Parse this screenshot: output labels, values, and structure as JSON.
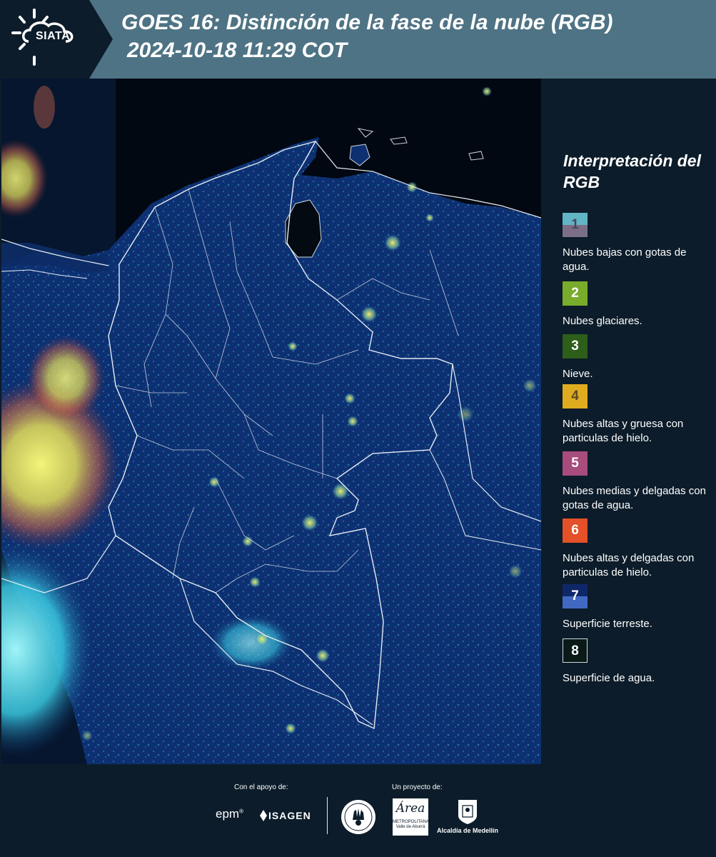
{
  "header": {
    "logo_text": "SIATA",
    "title": "GOES 16: Distinción de la fase de la nube (RGB)",
    "subtitle": "2024-10-18 11:29 COT"
  },
  "legend": {
    "title": "Interpretación del RGB",
    "items": [
      {
        "number": "1",
        "label": "Nubes bajas con gotas de agua.",
        "color_top": "#62b5c4",
        "color_bottom": "#7b6e88",
        "number_color": "#4a4658"
      },
      {
        "number": "2",
        "label": "Nubes glaciares.",
        "color_top": "#7aac2c",
        "color_bottom": "#7aac2c",
        "number_color": "#ffffff"
      },
      {
        "number": "3",
        "label": "Nieve.",
        "color_top": "#2d5e1a",
        "color_bottom": "#2d5e1a",
        "number_color": "#ffffff"
      },
      {
        "number": "4",
        "label": "Nubes altas y gruesa con particulas de hielo.",
        "color_top": "#e0ac1f",
        "color_bottom": "#e0ac1f",
        "number_color": "#5a4a2a"
      },
      {
        "number": "5",
        "label": "Nubes medias y delgadas con gotas de agua.",
        "color_top": "#a74c7c",
        "color_bottom": "#a74c7c",
        "number_color": "#ffffff"
      },
      {
        "number": "6",
        "label": "Nubes altas y delgadas con particulas de hielo.",
        "color_top": "#e45027",
        "color_bottom": "#e45027",
        "number_color": "#ffffff"
      },
      {
        "number": "7",
        "label": "Superficie terreste.",
        "color_top": "#0e2769",
        "color_bottom": "#4169c4",
        "number_color": "#ffffff"
      },
      {
        "number": "8",
        "label": "Superficie de agua.",
        "color_top": "#0a1a16",
        "color_bottom": "#0a1a16",
        "number_color": "#ffffff"
      }
    ]
  },
  "footer": {
    "support_label": "Con el apoyo de:",
    "project_label": "Un proyecto de:",
    "epm_text": "epm",
    "isagen_text": "ISAGEN",
    "area_text_1": "Área",
    "area_text_2": "METROPOLITANA",
    "area_text_3": "Valle de Aburrá",
    "medellin_text": "Alcaldía de Medellín"
  },
  "colors": {
    "header_bg": "#4e7384",
    "logo_bg": "#0c1c2a",
    "page_bg": "#0c1c2a",
    "map_land": "#0c2d6a",
    "map_ocean": "#020812"
  }
}
